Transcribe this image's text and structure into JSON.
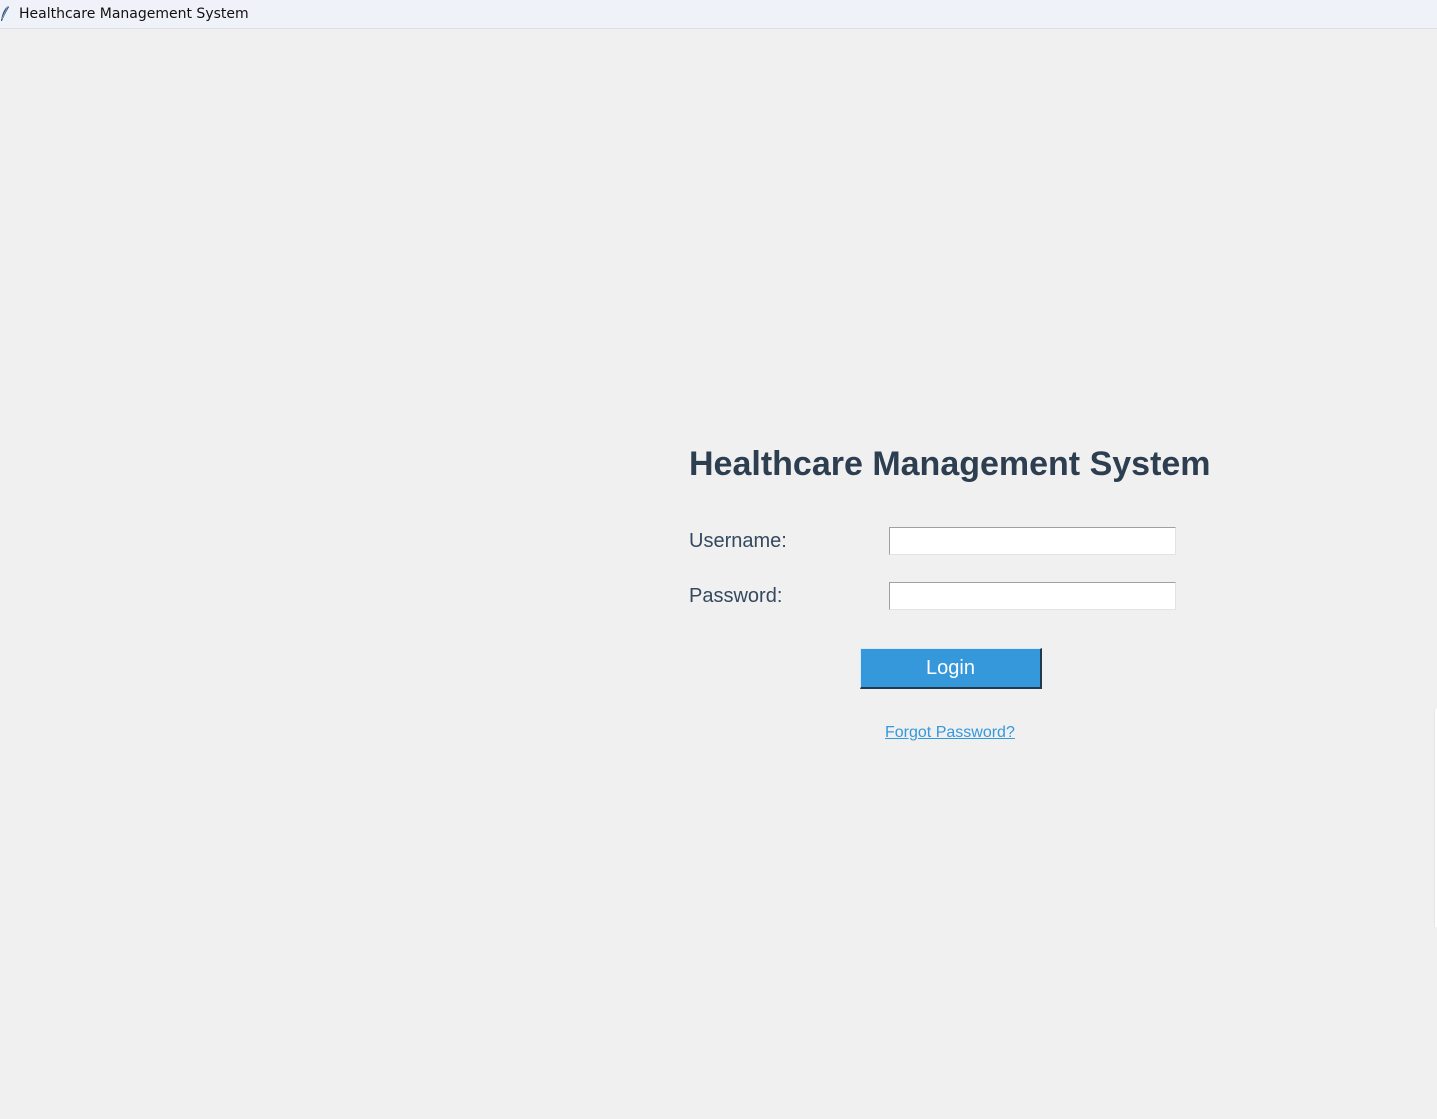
{
  "window": {
    "title": "Healthcare Management System",
    "icon": "feather-icon"
  },
  "login": {
    "heading": "Healthcare Management System",
    "username_label": "Username:",
    "username_value": "",
    "password_label": "Password:",
    "password_value": "",
    "login_button": "Login",
    "forgot_link": "Forgot Password?"
  },
  "colors": {
    "heading": "#2c3e50",
    "label": "#34495e",
    "accent": "#3498db",
    "background": "#f0f0f0"
  }
}
